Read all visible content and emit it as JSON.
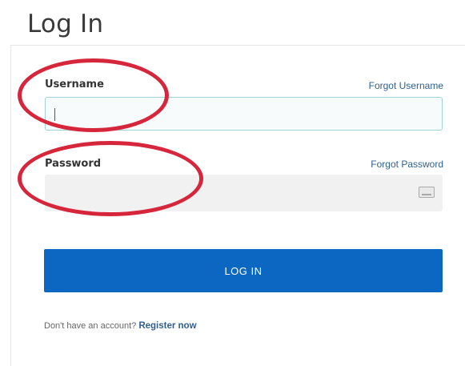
{
  "page": {
    "title": "Log In"
  },
  "form": {
    "username": {
      "label": "Username",
      "link": "Forgot Username",
      "value": ""
    },
    "password": {
      "label": "Password",
      "link": "Forgot Password",
      "value": ""
    },
    "submit_label": "LOG IN",
    "register_prompt": "Don't have an account?",
    "register_link": "Register now"
  },
  "colors": {
    "button": "#0b67c2",
    "link": "#2f5f8f",
    "annotation": "#d6263c"
  }
}
